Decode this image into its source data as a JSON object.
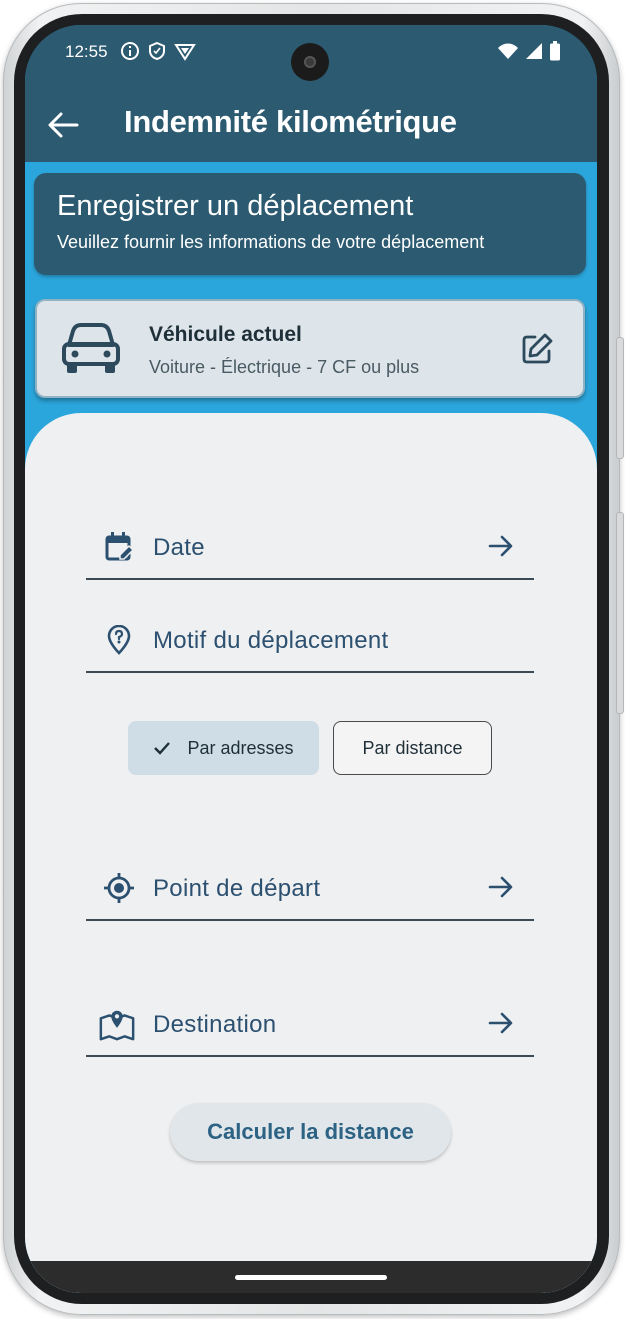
{
  "status_bar": {
    "time": "12:55"
  },
  "app_bar": {
    "title": "Indemnité kilométrique"
  },
  "info_card": {
    "title": "Enregistrer un déplacement",
    "subtitle": "Veuillez fournir les informations de votre déplacement"
  },
  "vehicle": {
    "label": "Véhicule actuel",
    "value": "Voiture - Électrique - 7 CF ou plus"
  },
  "form": {
    "date_label": "Date",
    "motif_label": "Motif du déplacement",
    "segment": {
      "option_addresses": "Par adresses",
      "option_distance": "Par distance",
      "selected": "Par adresses"
    },
    "depart_label": "Point de départ",
    "destination_label": "Destination",
    "calculate_button": "Calculer la distance"
  },
  "colors": {
    "appbar": "#2c5a70",
    "accent": "#2ba6dc",
    "sheet": "#eff0f1",
    "icon": "#2c5070"
  }
}
